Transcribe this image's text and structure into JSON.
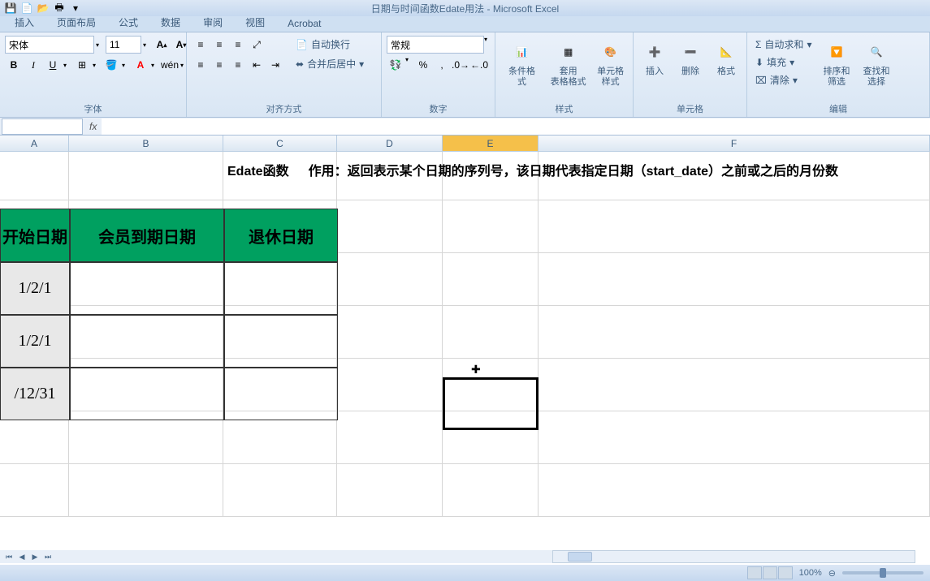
{
  "title": "日期与时间函数Edate用法 - Microsoft Excel",
  "tabs": {
    "insert": "插入",
    "pageLayout": "页面布局",
    "formulas": "公式",
    "data": "数据",
    "review": "审阅",
    "view": "视图",
    "acrobat": "Acrobat"
  },
  "ribbon": {
    "font": {
      "label": "字体",
      "family": "宋体",
      "size": "11",
      "boldSym": "B",
      "italicSym": "I",
      "underlineSym": "U"
    },
    "alignment": {
      "label": "对齐方式",
      "wrapText": "自动换行",
      "mergeCenter": "合并后居中"
    },
    "number": {
      "label": "数字",
      "format": "常规"
    },
    "styles": {
      "label": "样式",
      "conditional": "条件格式",
      "tableFormat": "套用\n表格格式",
      "cellStyles": "单元格\n样式"
    },
    "cells": {
      "label": "单元格",
      "insert": "插入",
      "delete": "删除",
      "format": "格式"
    },
    "editing": {
      "label": "编辑",
      "autoSum": "自动求和",
      "fill": "填充",
      "clear": "清除",
      "sortFilter": "排序和\n筛选",
      "findSelect": "查找和\n选择"
    }
  },
  "columns": {
    "A": "A",
    "B": "B",
    "C": "C",
    "D": "D",
    "E": "E",
    "F": "F"
  },
  "sheet": {
    "c1Text": "Edate函数",
    "d1Text": "作用：返回表示某个日期的序列号，该日期代表指定日期（start_date）之前或之后的月份数",
    "headerA": "开始日期",
    "headerB": "会员到期日期",
    "headerC": "退休日期",
    "rowA1": "1/2/1",
    "rowA2": "1/2/1",
    "rowA3": "/12/31"
  },
  "status": {
    "zoom": "100%"
  }
}
